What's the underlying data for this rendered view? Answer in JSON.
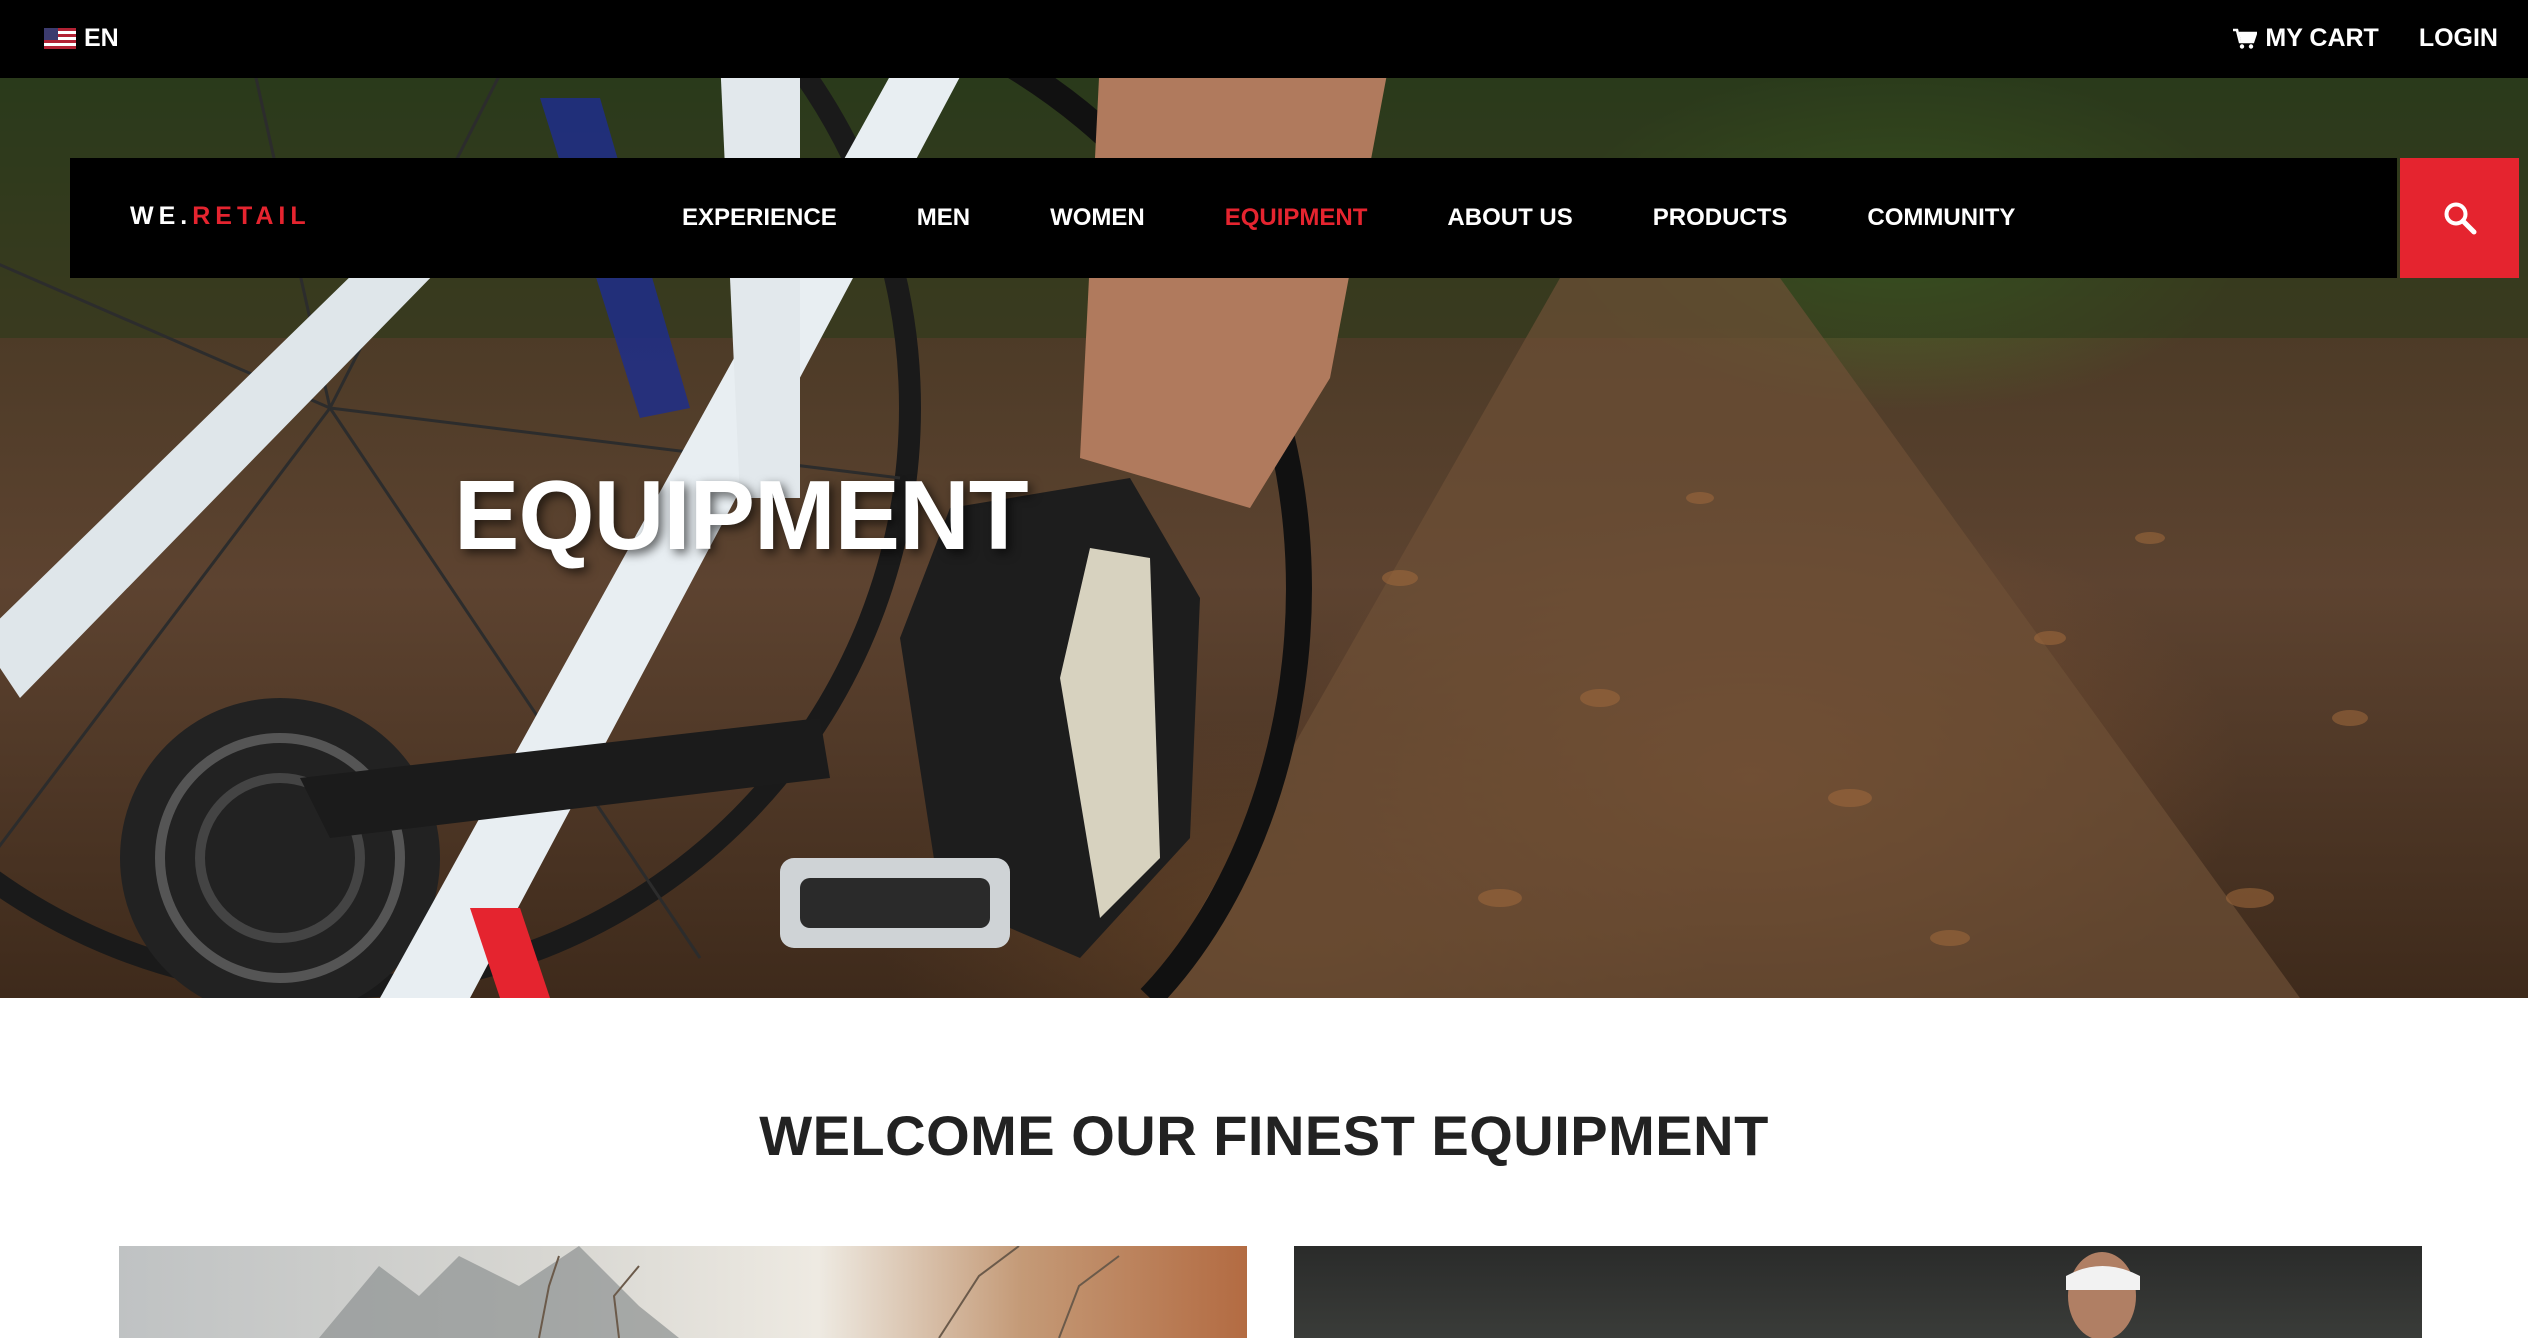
{
  "topbar": {
    "language": "EN",
    "language_flag_icon": "us-flag-icon",
    "cart_icon": "shopping-cart-icon",
    "cart_label": "MY CART",
    "login_label": "LOGIN"
  },
  "brand": {
    "logo_white": "WE.",
    "logo_red": "RETAIL"
  },
  "nav": {
    "items": [
      {
        "label": "EXPERIENCE",
        "active": false
      },
      {
        "label": "MEN",
        "active": false
      },
      {
        "label": "WOMEN",
        "active": false
      },
      {
        "label": "EQUIPMENT",
        "active": true
      },
      {
        "label": "ABOUT US",
        "active": false
      },
      {
        "label": "PRODUCTS",
        "active": false
      },
      {
        "label": "COMMUNITY",
        "active": false
      }
    ],
    "search_icon": "search-icon"
  },
  "hero": {
    "title": "EQUIPMENT"
  },
  "section": {
    "heading": "WELCOME OUR FINEST EQUIPMENT"
  },
  "colors": {
    "accent": "#e5242f",
    "bar": "#000000",
    "heading": "#222222"
  }
}
